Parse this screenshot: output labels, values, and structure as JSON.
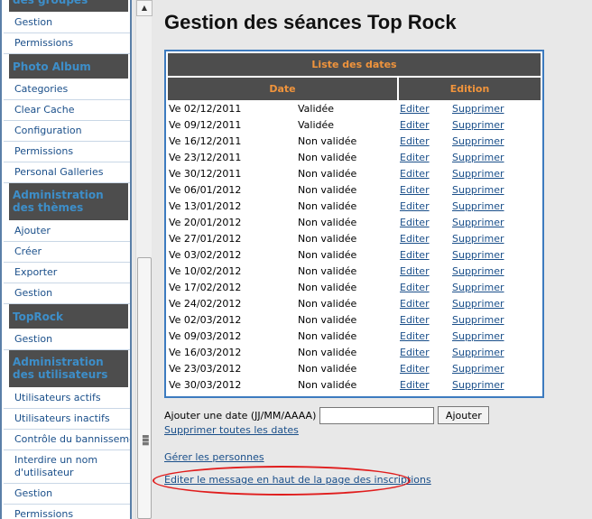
{
  "sidebar": {
    "sections": [
      {
        "title": "des groupes",
        "items": [
          "Gestion",
          "Permissions"
        ]
      },
      {
        "title": "Photo Album",
        "items": [
          "Categories",
          "Clear Cache",
          "Configuration",
          "Permissions",
          "Personal Galleries"
        ]
      },
      {
        "title": "Administration des thèmes",
        "items": [
          "Ajouter",
          "Créer",
          "Exporter",
          "Gestion"
        ]
      },
      {
        "title": "TopRock",
        "items": [
          "Gestion"
        ]
      },
      {
        "title": "Administration des utilisateurs",
        "items": [
          "Utilisateurs actifs",
          "Utilisateurs inactifs",
          "Contrôle du bannissement",
          "Interdire un nom d'utilisateur",
          "Gestion",
          "Permissions"
        ]
      }
    ]
  },
  "main": {
    "title": "Gestion des séances Top Rock",
    "table": {
      "caption": "Liste des dates",
      "col_date": "Date",
      "col_edit": "Edition",
      "edit_label": "Editer",
      "delete_label": "Supprimer",
      "rows": [
        {
          "date": "Ve 02/12/2011",
          "status": "Validée"
        },
        {
          "date": "Ve 09/12/2011",
          "status": "Validée"
        },
        {
          "date": "Ve 16/12/2011",
          "status": "Non validée"
        },
        {
          "date": "Ve 23/12/2011",
          "status": "Non validée"
        },
        {
          "date": "Ve 30/12/2011",
          "status": "Non validée"
        },
        {
          "date": "Ve 06/01/2012",
          "status": "Non validée"
        },
        {
          "date": "Ve 13/01/2012",
          "status": "Non validée"
        },
        {
          "date": "Ve 20/01/2012",
          "status": "Non validée"
        },
        {
          "date": "Ve 27/01/2012",
          "status": "Non validée"
        },
        {
          "date": "Ve 03/02/2012",
          "status": "Non validée"
        },
        {
          "date": "Ve 10/02/2012",
          "status": "Non validée"
        },
        {
          "date": "Ve 17/02/2012",
          "status": "Non validée"
        },
        {
          "date": "Ve 24/02/2012",
          "status": "Non validée"
        },
        {
          "date": "Ve 02/03/2012",
          "status": "Non validée"
        },
        {
          "date": "Ve 09/03/2012",
          "status": "Non validée"
        },
        {
          "date": "Ve 16/03/2012",
          "status": "Non validée"
        },
        {
          "date": "Ve 23/03/2012",
          "status": "Non validée"
        },
        {
          "date": "Ve 30/03/2012",
          "status": "Non validée"
        }
      ]
    },
    "add_date_label": "Ajouter une date (JJ/MM/AAAA)",
    "add_date_value": "",
    "add_button": "Ajouter",
    "delete_all_link": "Supprimer toutes les dates",
    "manage_people_link": "Gérer les personnes",
    "edit_message_link": "Editer le message en haut de la page des inscriptions"
  },
  "colors": {
    "header_bg": "#4d4d4d",
    "header_text": "#f0943c",
    "sidebar_header_text": "#3d8ec9",
    "link": "#1a4f8a",
    "table_border": "#3d7bbf",
    "annotation": "#e01d1d"
  }
}
